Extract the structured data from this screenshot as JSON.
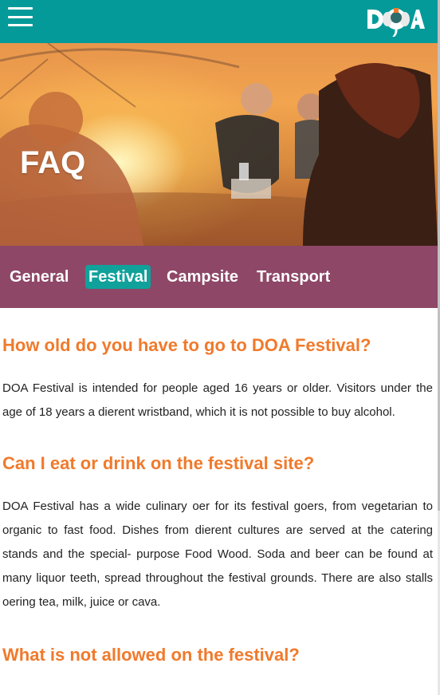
{
  "header": {
    "menu_icon": "hamburger-icon",
    "logo_text": "DOA",
    "colors": {
      "bar": "#049a9a",
      "accent": "#f07a2c",
      "tabs": "#8e4767",
      "active_tab": "#10a19b"
    }
  },
  "hero": {
    "title": "FAQ"
  },
  "tabs": [
    {
      "label": "General",
      "active": false
    },
    {
      "label": "Festival",
      "active": true
    },
    {
      "label": "Campsite",
      "active": false
    },
    {
      "label": "Transport",
      "active": false
    }
  ],
  "faq": [
    {
      "question": "How old do you have to go to DOA Festival?",
      "answer": "DOA Festival is intended for people aged 16 years or older. Visitors under the age of 18 years a dierent wristband, which it is not possible to buy alcohol."
    },
    {
      "question": "Can I eat or drink on the festival site?",
      "answer": "DOA Festival has a wide culinary oer for its festival goers, from vegetarian to organic to fast food. Dishes from dierent cultures are served at the catering stands and the special- purpose Food Wood. Soda and beer can be found at many liquor teeth, spread throughout the festival grounds. There are also stalls oering tea, milk, juice or cava."
    },
    {
      "question": "What is not allowed on the festival?",
      "answer": ""
    }
  ]
}
